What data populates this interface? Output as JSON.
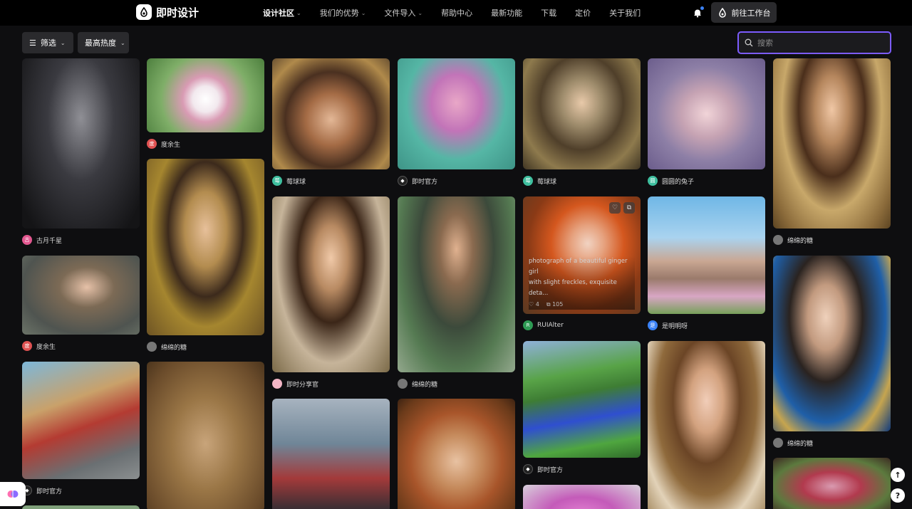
{
  "brand": {
    "name": "即时设计"
  },
  "nav": [
    {
      "label": "设计社区",
      "dropdown": true,
      "active": true
    },
    {
      "label": "我们的优势",
      "dropdown": true
    },
    {
      "label": "文件导入",
      "dropdown": true
    },
    {
      "label": "帮助中心"
    },
    {
      "label": "最新功能"
    },
    {
      "label": "下载"
    },
    {
      "label": "定价"
    },
    {
      "label": "关于我们"
    }
  ],
  "header": {
    "workbench_label": "前往工作台"
  },
  "toolbar": {
    "filter_label": "筛选",
    "sort_label": "最高热度"
  },
  "search": {
    "placeholder": "搜索",
    "value": ""
  },
  "colors": {
    "accent": "#7c5cff",
    "notify_dot": "#3b82f6",
    "background": "#0e0e10"
  },
  "cards": [
    {
      "author": "古月千星",
      "avatar_text": "古",
      "avatar_color": "#e2578f"
    },
    {
      "author": "度余生",
      "avatar_text": "度",
      "avatar_color": "#e05252"
    },
    {
      "author": "即时官方",
      "avatar_text": "",
      "avatar_color": "#222222"
    },
    {
      "author": "度余生",
      "avatar_text": "度",
      "avatar_color": "#e05252"
    },
    {
      "author": "绵绵的糖",
      "avatar_text": "",
      "avatar_color": "#777777"
    },
    {
      "author": "莓球球",
      "avatar_text": "莓",
      "avatar_color": "#3fbf9f"
    },
    {
      "author": "即时分享官",
      "avatar_text": "",
      "avatar_color": "#f3b6c6"
    },
    {
      "author": "即时官方",
      "avatar_text": "",
      "avatar_color": "#222222"
    },
    {
      "author": "绵绵的糖",
      "avatar_text": "",
      "avatar_color": "#777777"
    },
    {
      "author": "莓球球",
      "avatar_text": "莓",
      "avatar_color": "#3fbf9f"
    },
    {
      "author": "RUIAlter",
      "avatar_text": "R",
      "avatar_color": "#2e9b54"
    },
    {
      "author": "即时官方",
      "avatar_text": "",
      "avatar_color": "#222222"
    },
    {
      "author": "圆圆的兔子",
      "avatar_text": "圆",
      "avatar_color": "#3fbf9f"
    },
    {
      "author": "是明明呀",
      "avatar_text": "是",
      "avatar_color": "#3b82f6"
    },
    {
      "author": "绵绵的糖",
      "avatar_text": "",
      "avatar_color": "#777777"
    },
    {
      "author": "绵绵的糖",
      "avatar_text": "",
      "avatar_color": "#777777"
    }
  ],
  "hover_card": {
    "prompt_line1": "photograph of a beautiful ginger girl",
    "prompt_line2": "with slight freckles, exquisite deta...",
    "likes": "4",
    "comments": "105"
  },
  "icons": [
    "logo-icon",
    "chevron-down-icon",
    "bell-icon",
    "filter-icon",
    "search-icon",
    "heart-icon",
    "copy-icon",
    "arrow-up-icon",
    "help-icon",
    "brain-icon"
  ]
}
